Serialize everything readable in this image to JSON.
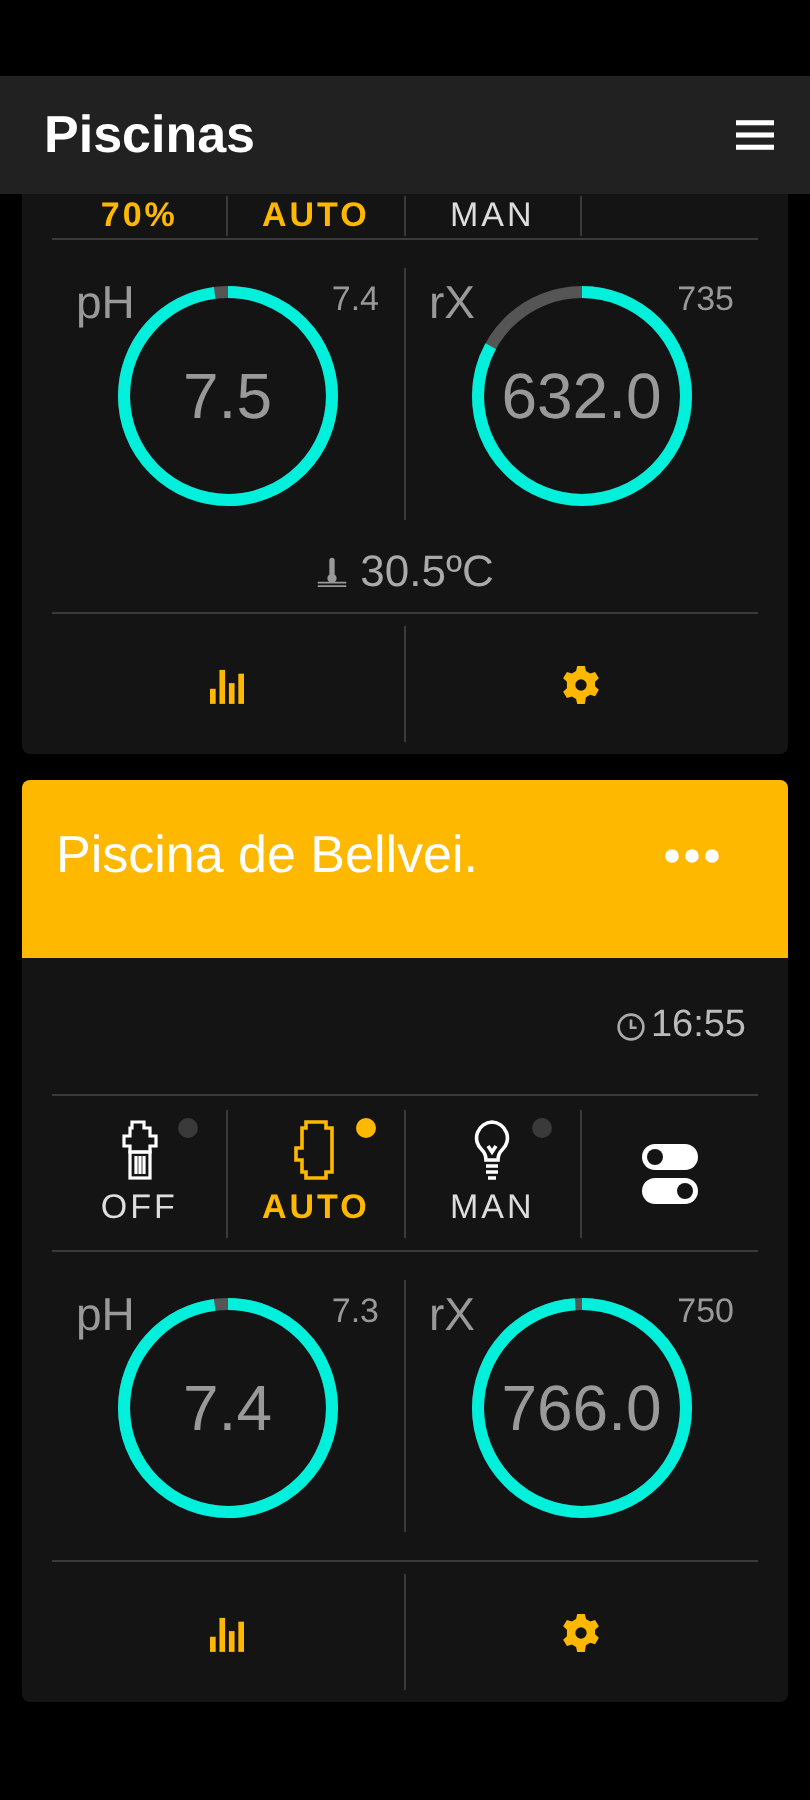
{
  "app_bar": {
    "title": "Piscinas"
  },
  "pools": [
    {
      "modes": [
        {
          "label": "70%",
          "active": true
        },
        {
          "label": "AUTO",
          "active": true
        },
        {
          "label": "MAN",
          "active": false
        }
      ],
      "gauges": [
        {
          "label": "pH",
          "setpoint": "7.4",
          "value": "7.5",
          "level": 0.98
        },
        {
          "label": "rX",
          "setpoint": "735",
          "value": "632.0",
          "level": 0.83
        }
      ],
      "temperature": "30.5ºC"
    },
    {
      "name": "Piscina de Bellvei.",
      "time": "16:55",
      "toggle": true,
      "modes": [
        {
          "label": "OFF",
          "active": false,
          "kind": "pump"
        },
        {
          "label": "AUTO",
          "active": true,
          "kind": "motor"
        },
        {
          "label": "MAN",
          "active": false,
          "kind": "bulb"
        }
      ],
      "gauges": [
        {
          "label": "pH",
          "setpoint": "7.3",
          "value": "7.4",
          "level": 0.98
        },
        {
          "label": "rX",
          "setpoint": "750",
          "value": "766.0",
          "level": 0.99
        }
      ]
    }
  ]
}
